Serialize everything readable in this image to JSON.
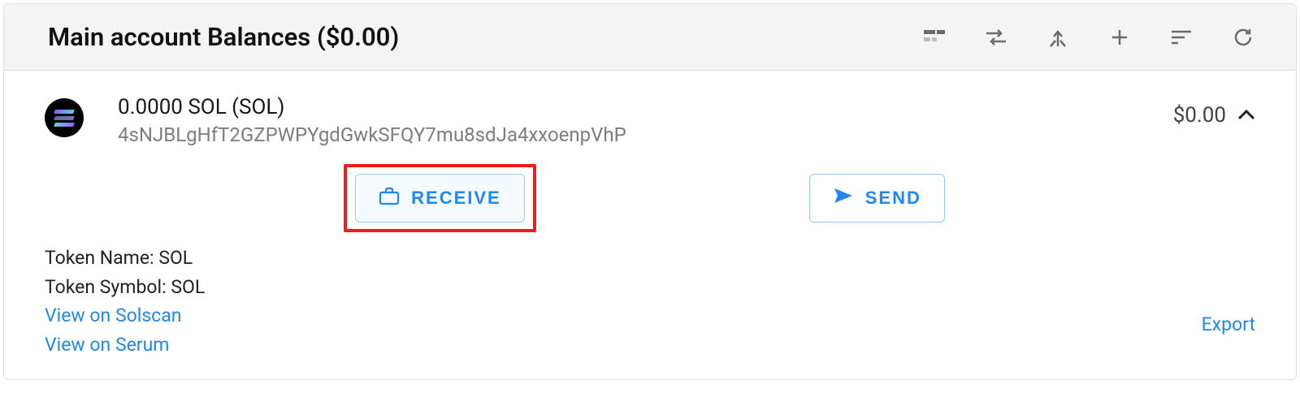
{
  "header": {
    "title": "Main account Balances ($0.00)"
  },
  "token": {
    "balance_line": "0.0000 SOL (SOL)",
    "address": "4sNJBLgHfT2GZPWPYgdGwkSFQY7mu8sdJa4xxoenpVhP",
    "usd_value": "$0.00"
  },
  "actions": {
    "receive_label": "RECEIVE",
    "send_label": "SEND"
  },
  "details": {
    "token_name_label": "Token Name: ",
    "token_name_value": "SOL",
    "token_symbol_label": "Token Symbol: ",
    "token_symbol_value": "SOL",
    "view_solscan": "View on Solscan",
    "view_serum": "View on Serum",
    "export": "Export"
  }
}
